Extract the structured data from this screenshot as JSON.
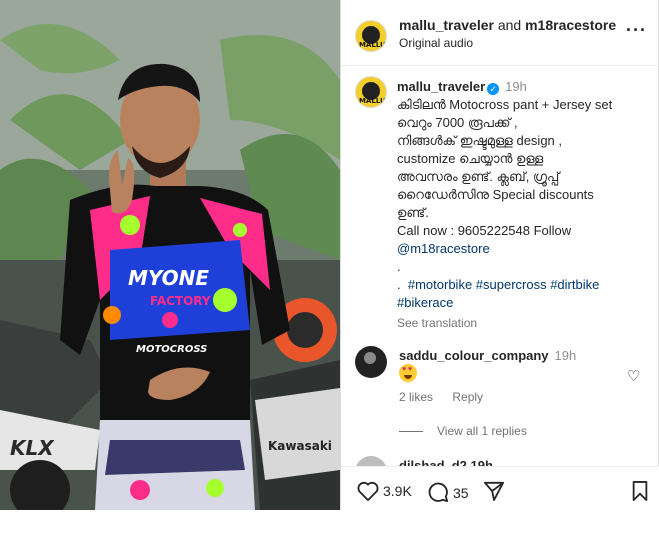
{
  "post": {
    "header": {
      "username": "mallu_traveler",
      "and": "and",
      "collaborator": "m18racestore",
      "audio": "Original audio",
      "more_icon": "more-horizontal-icon"
    },
    "caption": {
      "username": "mallu_traveler",
      "time": "19h",
      "text": "കിടിലൻ Motocross pant + Jersey set\nവെറും 7000 രൂപക്ക് ,\nനിങ്ങൾക് ഇഷ്ടമുള്ള design ,\ncustomize ചെയ്യാൻ ഉള്ള\nഅവസരം ഉണ്ട്. ക്ലബ്, ഗ്രൂപ്പ്\nറൈഡേർസിനു Special discounts\nഉണ്ട്.",
      "call": "Call now : 9605222548  Follow",
      "mention": "@m18racestore",
      "dot1": ".",
      "dot2": ".",
      "hashtags": "#motorbike #supercross #dirtbike #bikerace",
      "see_translation": "See translation"
    },
    "comment": {
      "username": "saddu_colour_company",
      "time": "19h",
      "emoji_icon": "heart-eyes-emoji-icon",
      "likes": "2 likes",
      "reply": "Reply",
      "view_replies": "View all 1 replies"
    },
    "next_comment": {
      "username": "dilshad_d2  19h"
    },
    "actions": {
      "likes_count": "3.9K",
      "comments_count": "35"
    },
    "media": {
      "jersey_text": {
        "brand": "MYONE",
        "factory": "FACTORY",
        "chest": "MOTOCROSS"
      },
      "bike_text": {
        "kx": "KLX",
        "brand": "Kawasaki"
      }
    },
    "colors": {
      "link": "#00376b",
      "verified": "#0095f6",
      "muted": "#737373",
      "jersey_pink": "#ff2d8a",
      "jersey_green": "#a6ff2e",
      "jersey_blue": "#1e3fd8"
    }
  }
}
